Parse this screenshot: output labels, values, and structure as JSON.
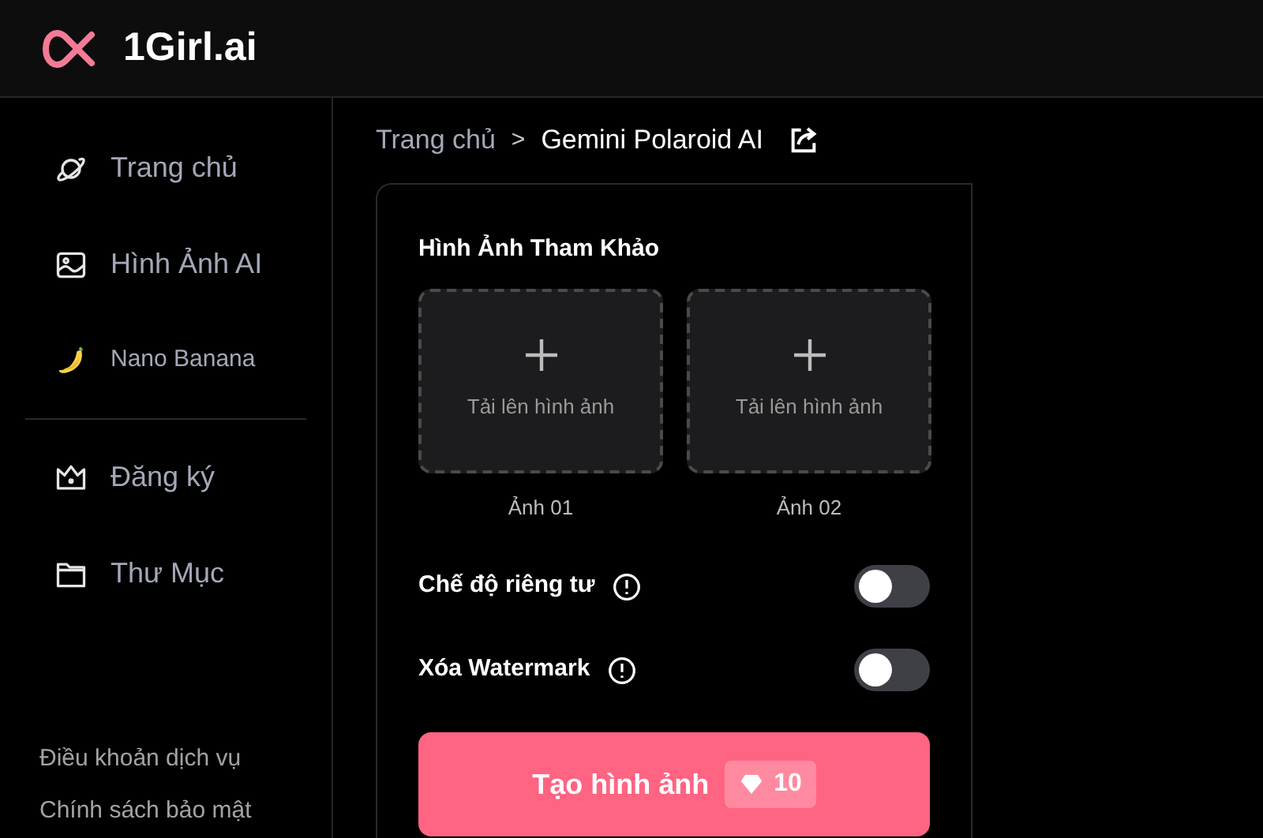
{
  "logo": {
    "text": "1Girl.ai"
  },
  "sidebar": {
    "items": [
      {
        "label": "Trang chủ",
        "small": false
      },
      {
        "label": "Hình Ảnh AI",
        "small": false
      },
      {
        "label": "Nano Banana",
        "small": true
      }
    ],
    "secondary_items": [
      {
        "label": "Đăng ký"
      },
      {
        "label": "Thư Mục"
      }
    ],
    "footer_links": [
      "Điều khoản dịch vụ",
      "Chính sách bảo mật"
    ]
  },
  "breadcrumb": {
    "parent": "Trang chủ",
    "separator": ">",
    "current": "Gemini Polaroid AI"
  },
  "reference_images": {
    "title": "Hình Ảnh Tham Khảo",
    "slots": [
      {
        "prompt": "Tải lên hình ảnh",
        "caption": "Ảnh 01"
      },
      {
        "prompt": "Tải lên hình ảnh",
        "caption": "Ảnh 02"
      }
    ]
  },
  "toggles": [
    {
      "label": "Chế độ riêng tư",
      "on": false
    },
    {
      "label": "Xóa Watermark",
      "on": false
    }
  ],
  "generate_button": {
    "label": "Tạo hình ảnh",
    "cost": "10"
  }
}
